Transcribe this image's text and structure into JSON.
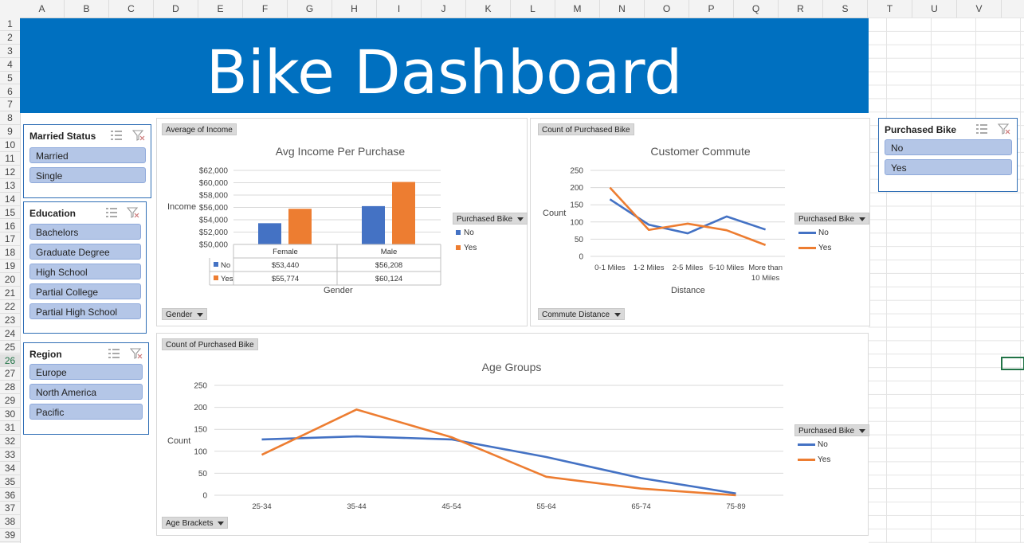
{
  "spreadsheet": {
    "columns": [
      "A",
      "B",
      "C",
      "D",
      "E",
      "F",
      "G",
      "H",
      "I",
      "J",
      "K",
      "L",
      "M",
      "N",
      "O",
      "P",
      "Q",
      "R",
      "S",
      "T",
      "U",
      "V"
    ],
    "rows": [
      "1",
      "2",
      "3",
      "4",
      "5",
      "6",
      "7",
      "8",
      "9",
      "10",
      "11",
      "12",
      "13",
      "14",
      "15",
      "16",
      "17",
      "18",
      "19",
      "20",
      "21",
      "22",
      "23",
      "24",
      "25",
      "26",
      "27",
      "28",
      "29",
      "30",
      "31",
      "32",
      "33",
      "34",
      "35",
      "36",
      "37",
      "38",
      "39"
    ],
    "selected_row": "26"
  },
  "banner": {
    "title": "Bike Dashboard",
    "color": "#0070c0"
  },
  "slicers": {
    "married": {
      "title": "Married Status",
      "items": [
        "Married",
        "Single"
      ]
    },
    "education": {
      "title": "Education",
      "items": [
        "Bachelors",
        "Graduate Degree",
        "High School",
        "Partial College",
        "Partial High School"
      ]
    },
    "region": {
      "title": "Region",
      "items": [
        "Europe",
        "North America",
        "Pacific"
      ]
    },
    "purchased": {
      "title": "Purchased Bike",
      "items": [
        "No",
        "Yes"
      ]
    }
  },
  "colors": {
    "no": "#4472c4",
    "yes": "#ed7d31",
    "slicer_item": "#b4c6e7"
  },
  "income_chart": {
    "value_button": "Average of Income",
    "axis_button": "Gender",
    "legend_button": "Purchased Bike",
    "title": "Avg Income Per Purchase",
    "ylabel": "Income",
    "xlabel": "Gender",
    "yticks": [
      "$62,000",
      "$60,000",
      "$58,000",
      "$56,000",
      "$54,000",
      "$52,000",
      "$50,000"
    ],
    "table": {
      "headers": [
        "Female",
        "Male"
      ],
      "rows": [
        {
          "series": "No",
          "values": [
            "$53,440",
            "$56,208"
          ]
        },
        {
          "series": "Yes",
          "values": [
            "$55,774",
            "$60,124"
          ]
        }
      ]
    }
  },
  "commute_chart": {
    "value_button": "Count of Purchased Bike",
    "axis_button": "Commute Distance",
    "legend_button": "Purchased Bike",
    "title": "Customer Commute",
    "ylabel": "Count",
    "xlabel": "Distance",
    "yticks": [
      "250",
      "200",
      "150",
      "100",
      "50",
      "0"
    ],
    "categories": [
      "0-1 Miles",
      "1-2 Miles",
      "2-5 Miles",
      "5-10 Miles",
      "More than 10 Miles"
    ]
  },
  "age_chart": {
    "value_button": "Count of Purchased Bike",
    "axis_button": "Age Brackets",
    "legend_button": "Purchased Bike",
    "title": "Age Groups",
    "ylabel": "Count",
    "yticks": [
      "250",
      "200",
      "150",
      "100",
      "50",
      "0"
    ],
    "categories": [
      "25-34",
      "35-44",
      "45-54",
      "55-64",
      "65-74",
      "75-89"
    ]
  },
  "chart_data": [
    {
      "type": "bar",
      "title": "Avg Income Per Purchase",
      "xlabel": "Gender",
      "ylabel": "Income",
      "categories": [
        "Female",
        "Male"
      ],
      "series": [
        {
          "name": "No",
          "values": [
            53440,
            56208
          ]
        },
        {
          "name": "Yes",
          "values": [
            55774,
            60124
          ]
        }
      ],
      "ylim": [
        50000,
        62000
      ],
      "legend": "right"
    },
    {
      "type": "line",
      "title": "Customer Commute",
      "xlabel": "Distance",
      "ylabel": "Count",
      "categories": [
        "0-1 Miles",
        "1-2 Miles",
        "2-5 Miles",
        "5-10 Miles",
        "More than 10 Miles"
      ],
      "series": [
        {
          "name": "No",
          "values": [
            166,
            92,
            67,
            116,
            78
          ]
        },
        {
          "name": "Yes",
          "values": [
            200,
            77,
            95,
            76,
            33
          ]
        }
      ],
      "ylim": [
        0,
        250
      ],
      "legend": "right"
    },
    {
      "type": "line",
      "title": "Age Groups",
      "xlabel": "",
      "ylabel": "Count",
      "categories": [
        "25-34",
        "35-44",
        "45-54",
        "55-64",
        "65-74",
        "75-89"
      ],
      "series": [
        {
          "name": "No",
          "values": [
            127,
            134,
            127,
            87,
            39,
            4
          ]
        },
        {
          "name": "Yes",
          "values": [
            92,
            195,
            132,
            42,
            15,
            0
          ]
        }
      ],
      "ylim": [
        0,
        250
      ],
      "legend": "right"
    }
  ]
}
